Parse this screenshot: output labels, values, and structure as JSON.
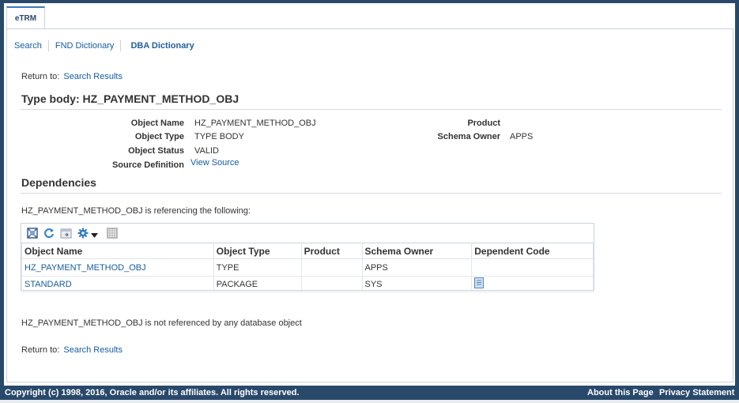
{
  "tabs": [
    {
      "label": "eTRM"
    }
  ],
  "subnav": [
    "Search",
    "FND Dictionary",
    "DBA Dictionary"
  ],
  "return_to": {
    "label": "Return to:",
    "link": "Search Results"
  },
  "title": "Type body: HZ_PAYMENT_METHOD_OBJ",
  "details": {
    "object_name": {
      "label": "Object Name",
      "value": "HZ_PAYMENT_METHOD_OBJ"
    },
    "object_type": {
      "label": "Object Type",
      "value": "TYPE BODY"
    },
    "object_status": {
      "label": "Object Status",
      "value": "VALID"
    },
    "source_definition": {
      "label": "Source Definition",
      "value": "View Source"
    },
    "product": {
      "label": "Product",
      "value": ""
    },
    "schema_owner": {
      "label": "Schema Owner",
      "value": "APPS"
    }
  },
  "dependencies": {
    "heading": "Dependencies",
    "referencing_text": "HZ_PAYMENT_METHOD_OBJ is referencing the following:",
    "toolbar_icons": [
      "detach-icon",
      "refresh-icon",
      "export-icon",
      "gear-icon",
      "dropdown-arrow-icon",
      "freeze-columns-icon"
    ],
    "columns": [
      "Object Name",
      "Object Type",
      "Product",
      "Schema Owner",
      "Dependent Code"
    ],
    "rows": [
      {
        "object_name": "HZ_PAYMENT_METHOD_OBJ",
        "object_type": "TYPE",
        "product": "",
        "schema_owner": "APPS",
        "dependent_code_icon": ""
      },
      {
        "object_name": "STANDARD",
        "object_type": "PACKAGE",
        "product": "",
        "schema_owner": "SYS",
        "dependent_code_icon": "document-icon"
      }
    ],
    "not_referenced_text": "HZ_PAYMENT_METHOD_OBJ is not referenced by any database object"
  },
  "footer": {
    "copyright": "Copyright (c) 1998, 2016, Oracle and/or its affiliates. All rights reserved.",
    "about": "About this Page",
    "privacy": "Privacy Statement"
  },
  "colors": {
    "header_bg": "#29496b",
    "link": "#145c9e",
    "border": "#c9d3dc"
  }
}
